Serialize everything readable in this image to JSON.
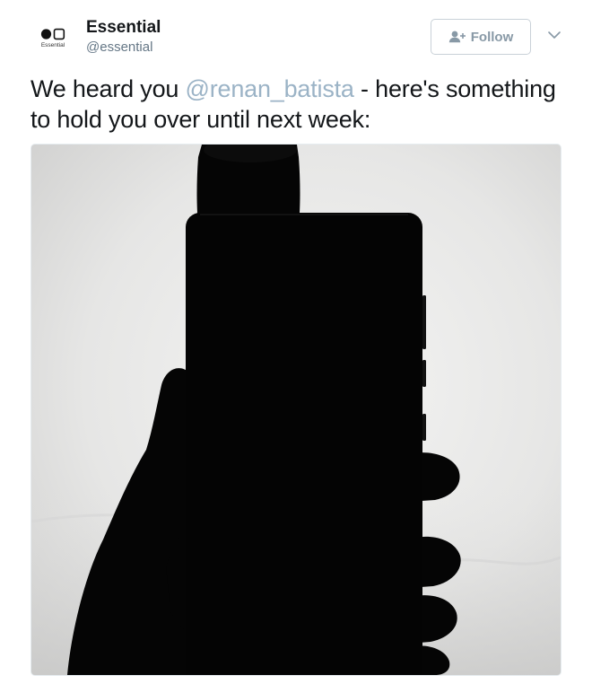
{
  "author": {
    "display_name": "Essential",
    "handle": "@essential",
    "avatar_caption": "Essential"
  },
  "actions": {
    "follow_label": "Follow"
  },
  "tweet": {
    "text_before": "We heard you ",
    "mention": "@renan_batista",
    "text_after": " - here's something to hold you over until next week:"
  },
  "media": {
    "image_icon": "photo",
    "description_icon": "silhouette-phone-in-hand"
  },
  "colors": {
    "text": "#14171a",
    "secondary": "#657786",
    "mention": "#9bb3c6",
    "follow_text": "#8899a6",
    "border": "#c9d1d8"
  },
  "icons": {
    "follow": "add-user-icon",
    "more": "chevron-down-icon",
    "logo": "essential-logo-icon"
  }
}
